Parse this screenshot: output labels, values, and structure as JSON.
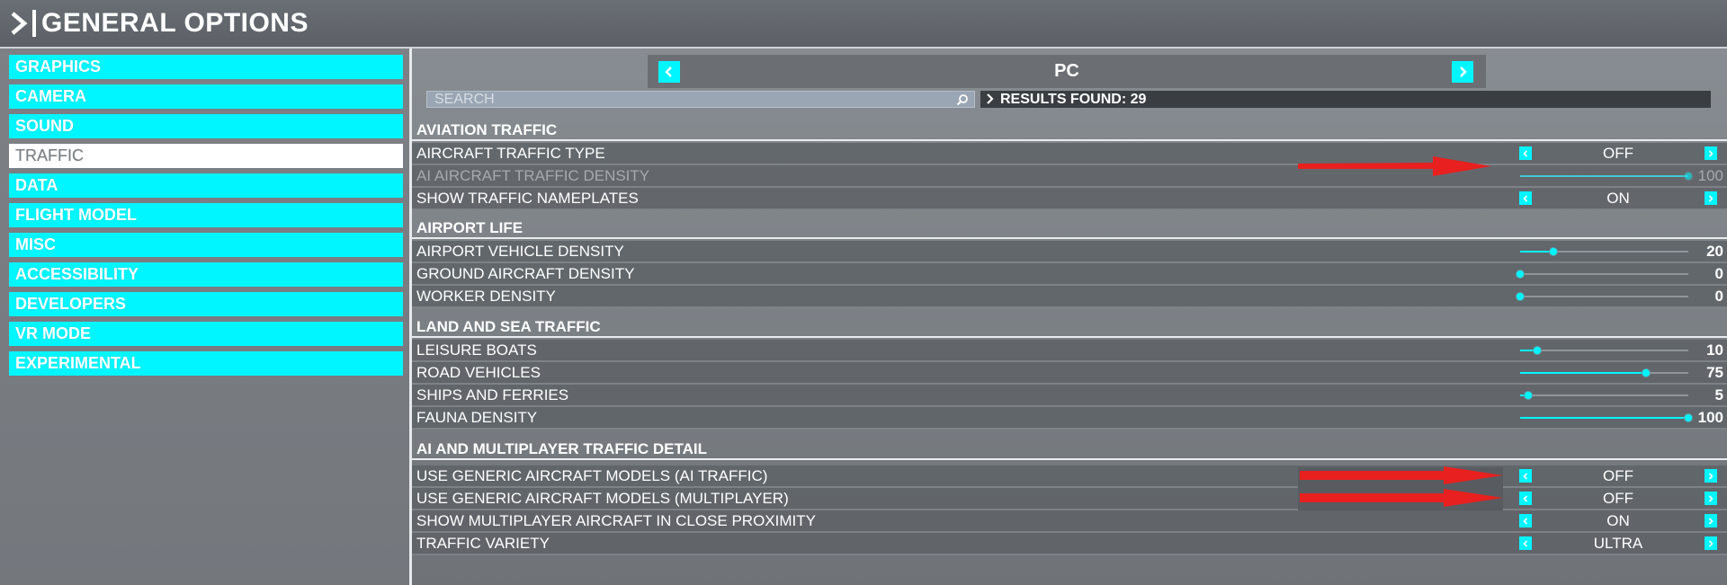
{
  "header": {
    "title": "GENERAL OPTIONS"
  },
  "sidebar": {
    "items": [
      {
        "label": "GRAPHICS",
        "active": false
      },
      {
        "label": "CAMERA",
        "active": false
      },
      {
        "label": "SOUND",
        "active": false
      },
      {
        "label": "TRAFFIC",
        "active": true
      },
      {
        "label": "DATA",
        "active": false
      },
      {
        "label": "FLIGHT MODEL",
        "active": false
      },
      {
        "label": "MISC",
        "active": false
      },
      {
        "label": "ACCESSIBILITY",
        "active": false
      },
      {
        "label": "DEVELOPERS",
        "active": false
      },
      {
        "label": "VR MODE",
        "active": false
      },
      {
        "label": "EXPERIMENTAL",
        "active": false
      }
    ]
  },
  "platform": {
    "name": "PC"
  },
  "search": {
    "placeholder": "SEARCH",
    "results_text": "RESULTS FOUND: 29"
  },
  "sections": [
    {
      "title": "AVIATION TRAFFIC",
      "rows": [
        {
          "label": "AIRCRAFT TRAFFIC TYPE",
          "type": "select",
          "value": "OFF"
        },
        {
          "label": "AI AIRCRAFT TRAFFIC DENSITY",
          "type": "slider",
          "value": "100",
          "level": 1.0,
          "dim": true
        },
        {
          "label": "SHOW TRAFFIC NAMEPLATES",
          "type": "select",
          "value": "ON"
        }
      ]
    },
    {
      "title": "AIRPORT LIFE",
      "rows": [
        {
          "label": "AIRPORT VEHICLE DENSITY",
          "type": "slider",
          "value": "20",
          "level": 0.2
        },
        {
          "label": "GROUND AIRCRAFT DENSITY",
          "type": "slider",
          "value": "0",
          "level": 0.0
        },
        {
          "label": "WORKER DENSITY",
          "type": "slider",
          "value": "0",
          "level": 0.0
        }
      ]
    },
    {
      "title": "LAND AND SEA TRAFFIC",
      "rows": [
        {
          "label": "LEISURE BOATS",
          "type": "slider",
          "value": "10",
          "level": 0.1
        },
        {
          "label": "ROAD VEHICLES",
          "type": "slider",
          "value": "75",
          "level": 0.75
        },
        {
          "label": "SHIPS AND FERRIES",
          "type": "slider",
          "value": "5",
          "level": 0.05
        },
        {
          "label": "FAUNA DENSITY",
          "type": "slider",
          "value": "100",
          "level": 1.0
        }
      ]
    },
    {
      "title": "AI AND MULTIPLAYER TRAFFIC DETAIL",
      "rows": [
        {
          "label": "USE GENERIC AIRCRAFT MODELS (AI TRAFFIC)",
          "type": "select",
          "value": "OFF"
        },
        {
          "label": "USE GENERIC AIRCRAFT MODELS (MULTIPLAYER)",
          "type": "select",
          "value": "OFF"
        },
        {
          "label": "SHOW MULTIPLAYER AIRCRAFT IN CLOSE PROXIMITY",
          "type": "select",
          "value": "ON"
        },
        {
          "label": "TRAFFIC VARIETY",
          "type": "select",
          "value": "ULTRA"
        }
      ]
    }
  ],
  "colors": {
    "accent": "#00f6ff",
    "annotation": "#e8201f"
  },
  "annotations": [
    {
      "name": "red-arrow-aircraft-traffic-type"
    },
    {
      "name": "red-arrow-generic-ai"
    },
    {
      "name": "red-arrow-generic-multiplayer"
    }
  ]
}
